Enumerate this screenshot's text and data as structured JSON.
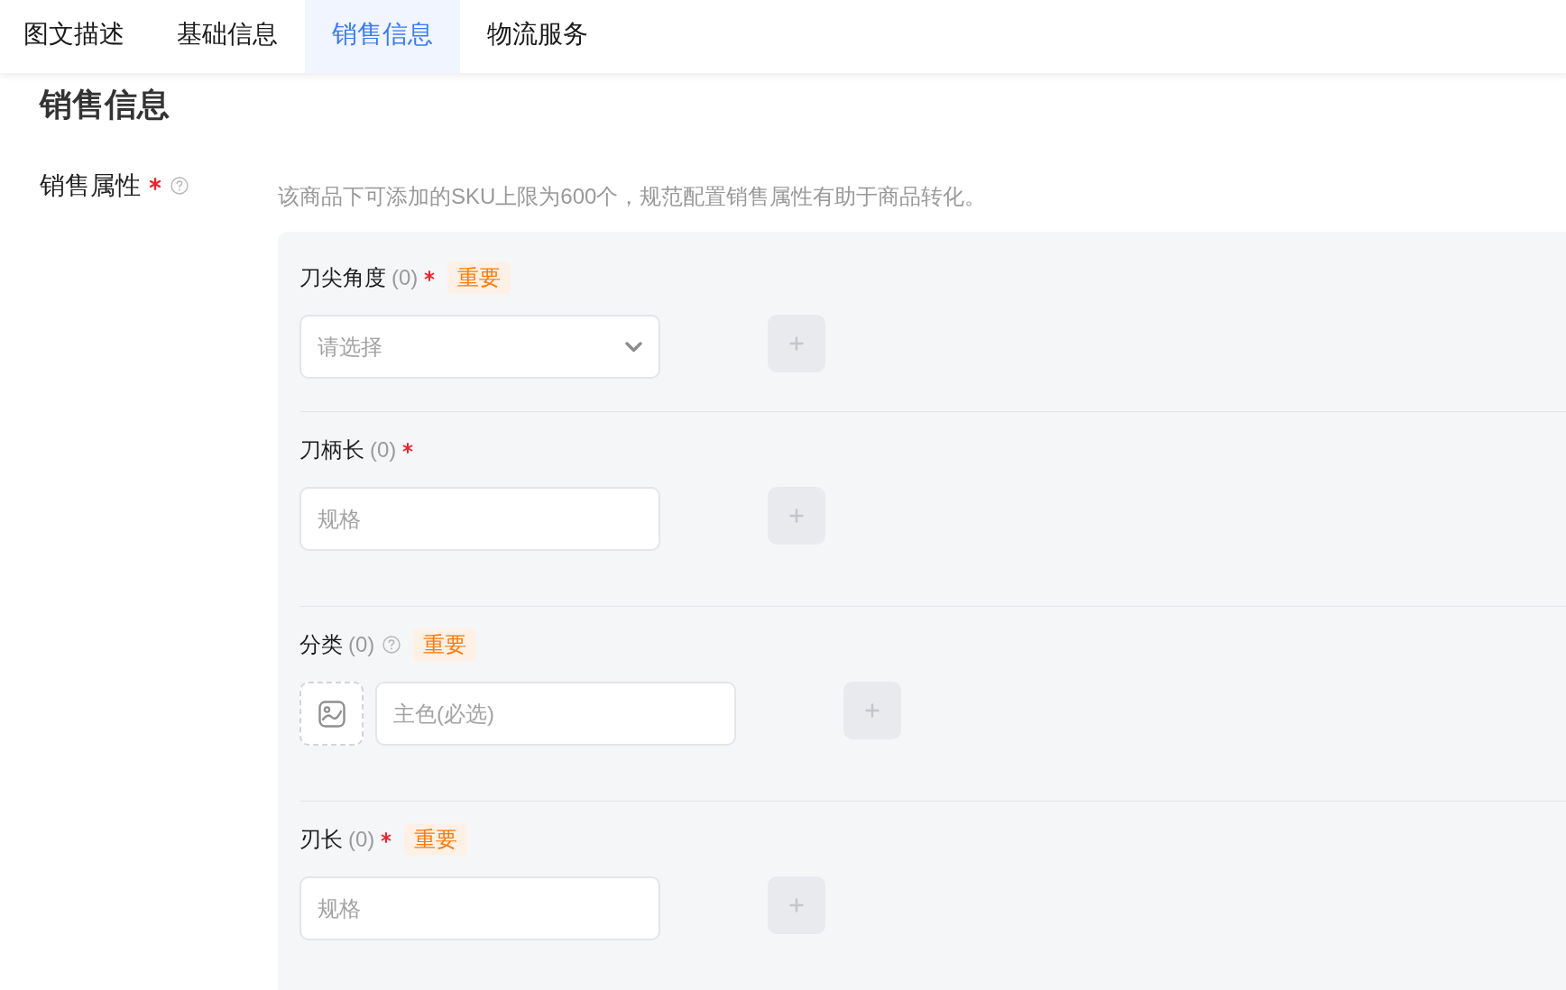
{
  "tabs": [
    {
      "label": "图文描述",
      "selected": false
    },
    {
      "label": "基础信息",
      "selected": false
    },
    {
      "label": "销售信息",
      "selected": true
    },
    {
      "label": "物流服务",
      "selected": false
    }
  ],
  "section_title": "销售信息",
  "sales_attributes": {
    "label": "销售属性",
    "required": true,
    "help": true,
    "hint": "该商品下可添加的SKU上限为600个，规范配置销售属性有助于商品转化。",
    "groups": [
      {
        "name": "刀尖角度",
        "count": "(0)",
        "required": true,
        "help": false,
        "badge": "重要",
        "field": {
          "kind": "select",
          "placeholder": "请选择"
        }
      },
      {
        "name": "刀柄长",
        "count": "(0)",
        "required": true,
        "help": false,
        "field": {
          "kind": "text",
          "placeholder": "规格"
        }
      },
      {
        "name": "分类",
        "count": "(0)",
        "required": false,
        "help": true,
        "badge": "重要",
        "field": {
          "kind": "image_text",
          "placeholder": "主色(必选)"
        }
      },
      {
        "name": "刃长",
        "count": "(0)",
        "required": true,
        "help": false,
        "badge": "重要",
        "field": {
          "kind": "text",
          "placeholder": "规格"
        }
      }
    ]
  }
}
